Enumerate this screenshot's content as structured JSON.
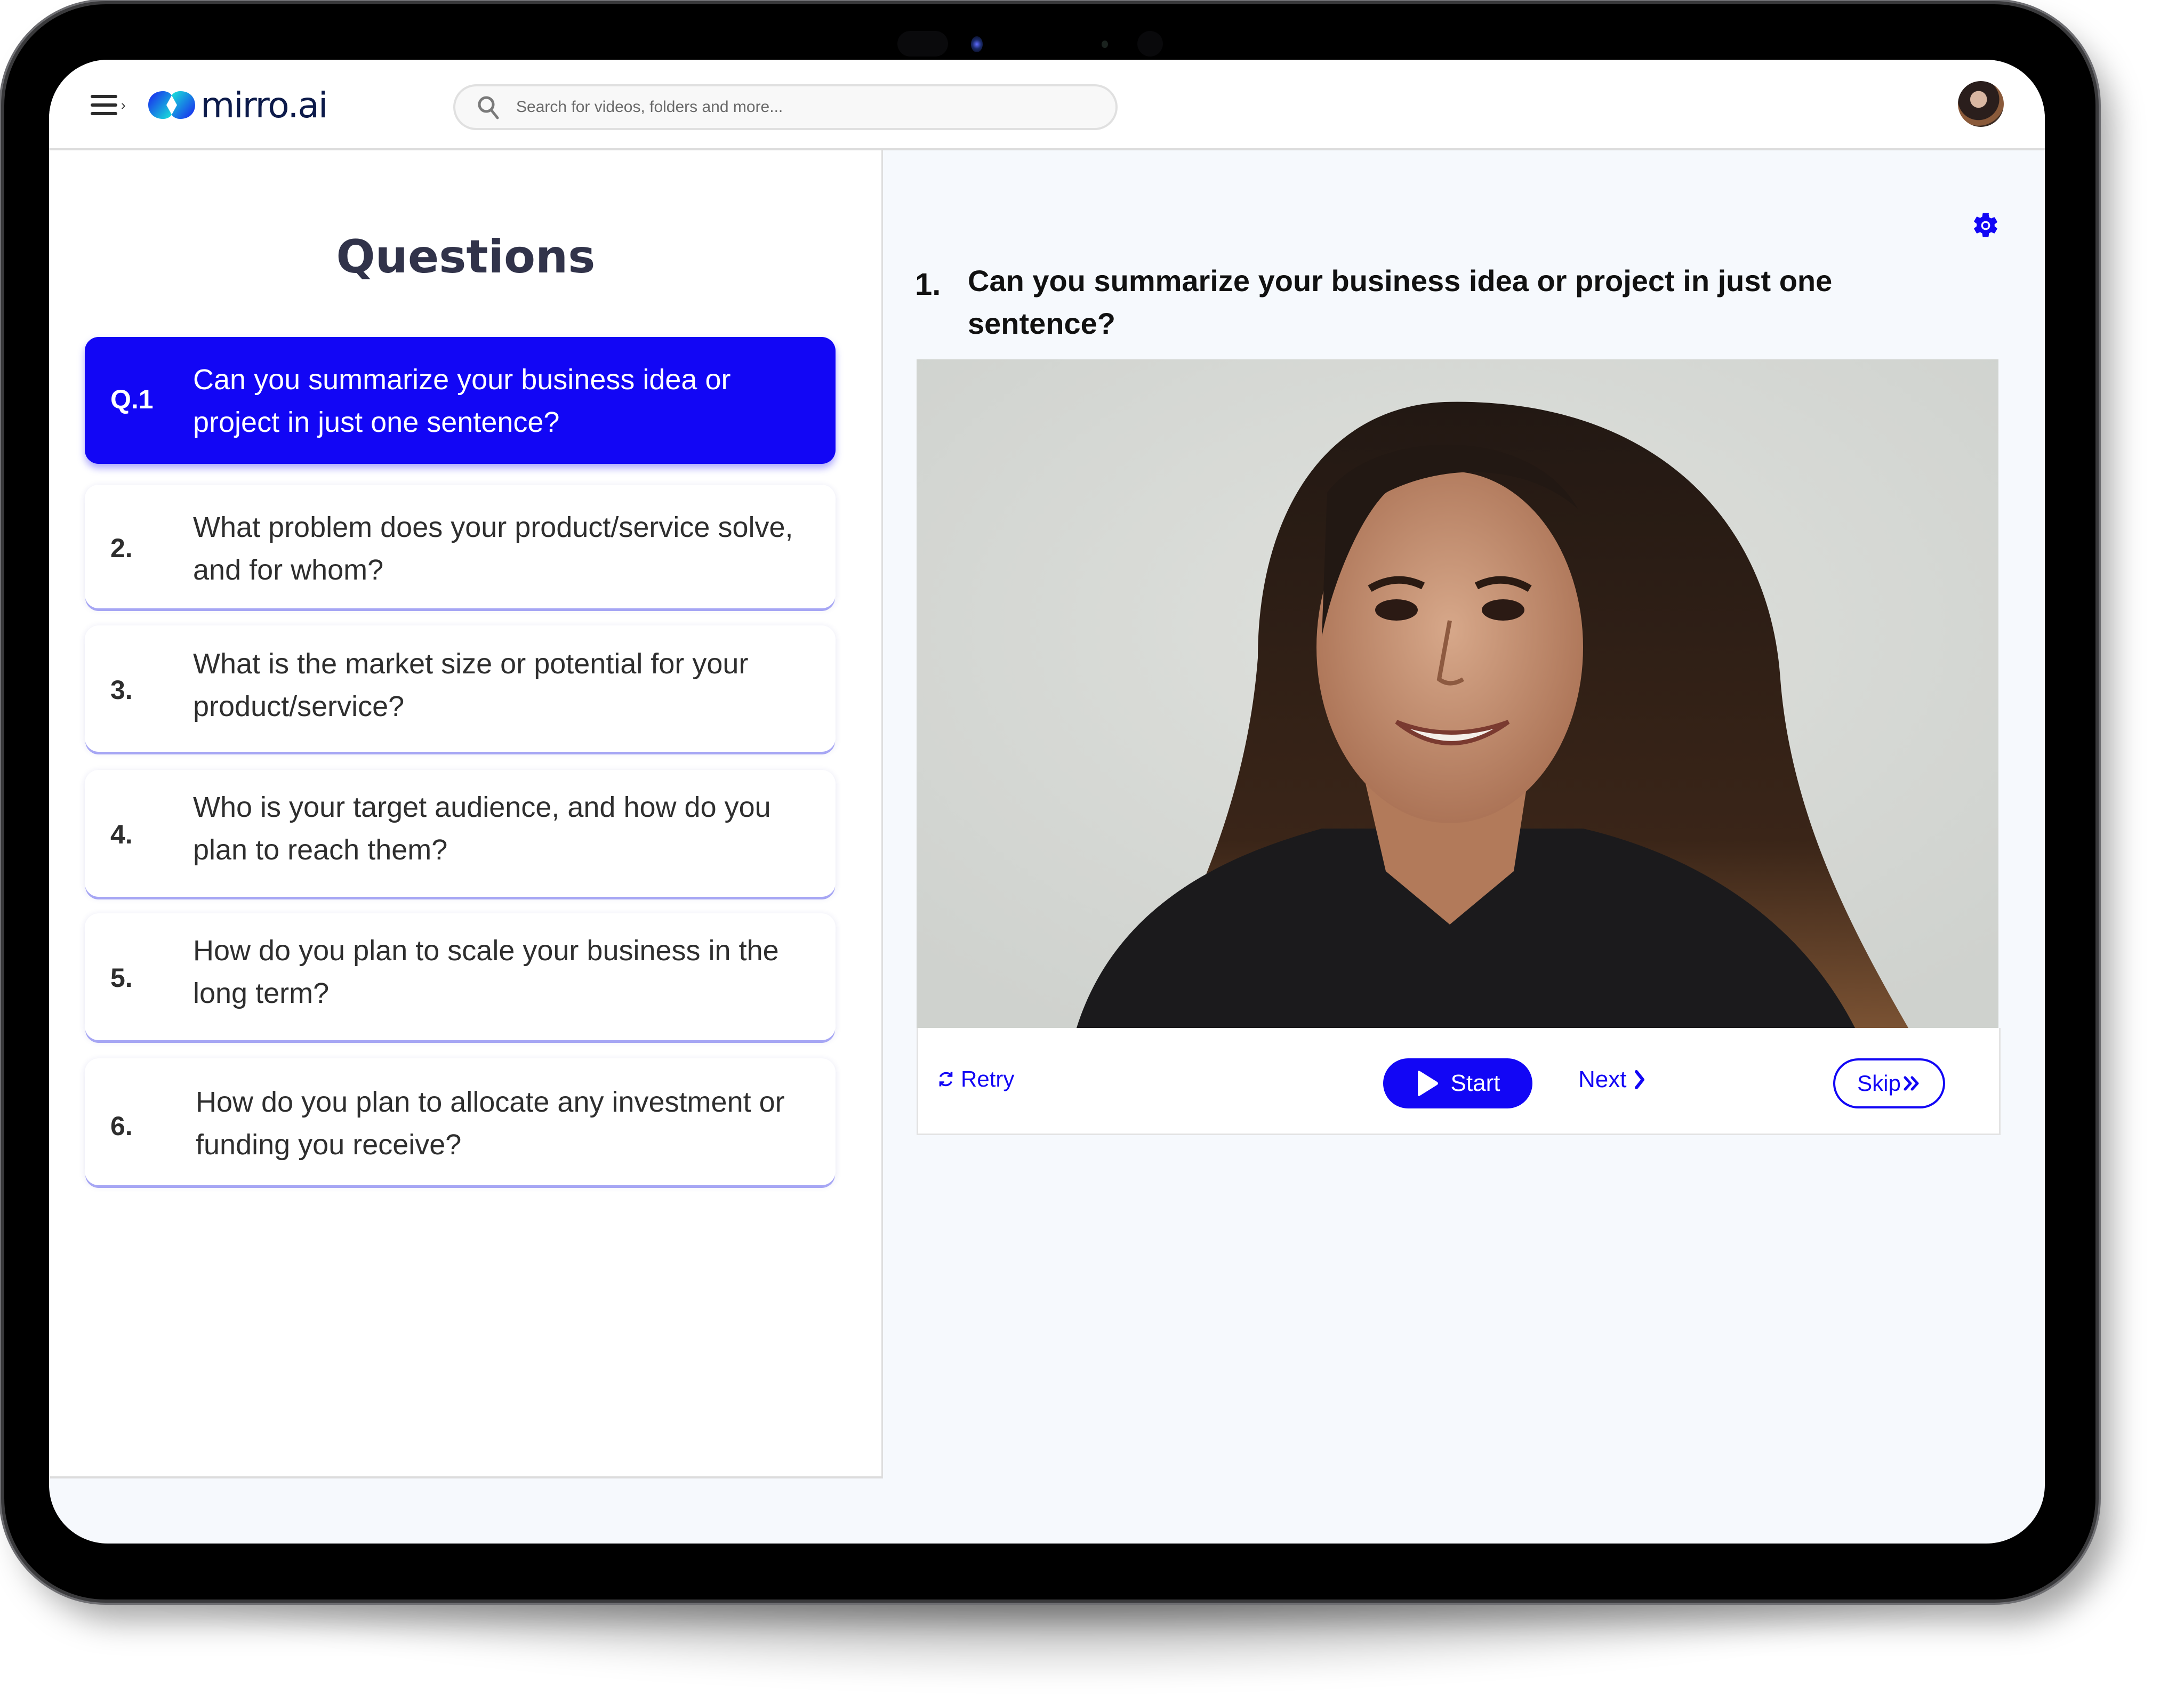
{
  "app": {
    "brand": "mirro.ai",
    "accent_color": "#1206f5",
    "title_color": "#31334a"
  },
  "header": {
    "menu_icon": "hamburger-menu-icon",
    "search": {
      "placeholder": "Search for videos, folders and more...",
      "value": ""
    },
    "avatar_icon": "user-avatar"
  },
  "questions_panel": {
    "title": "Questions",
    "items": [
      {
        "number": "Q.1",
        "text": "Can you summarize your business idea or project in just one sentence?",
        "active": true
      },
      {
        "number": "2.",
        "text": "What problem does your product/service solve, and for whom?",
        "active": false
      },
      {
        "number": "3.",
        "text": "What is the market size or potential for your product/service?",
        "active": false
      },
      {
        "number": "4.",
        "text": "Who is your target audience, and how do you plan to reach them?",
        "active": false
      },
      {
        "number": "5.",
        "text": "How do you plan to scale your business in the long term?",
        "active": false
      },
      {
        "number": "6.",
        "text": "How do you plan to allocate any investment or funding you receive?",
        "active": false
      }
    ]
  },
  "current_question": {
    "number": "1.",
    "text": "Can you summarize your business idea or project in just one sentence?",
    "settings_icon": "gear-icon"
  },
  "recorder": {
    "preview": "camera preview of a smiling woman with long dark hair",
    "retry_label": "Retry",
    "start_label": "Start",
    "next_label": "Next",
    "skip_label": "Skip"
  }
}
